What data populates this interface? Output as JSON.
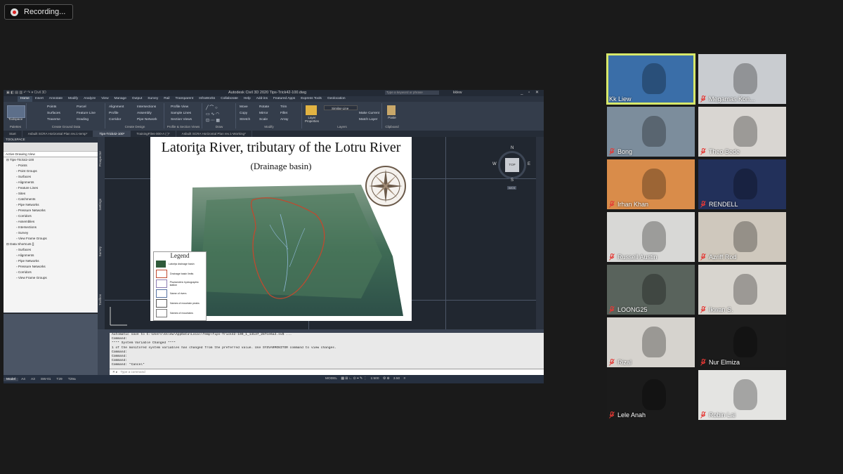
{
  "recording": {
    "label": "Recording..."
  },
  "autocad": {
    "window_title": "Autodesk Civil 3D 2020  Tips-Trick42-100.dwg",
    "workspace": "Civil 3D",
    "search_placeholder": "Type a keyword or phrase",
    "user": "kklew",
    "menu_tabs": [
      "Home",
      "Insert",
      "Annotate",
      "Modify",
      "Analyze",
      "View",
      "Manage",
      "Output",
      "Survey",
      "Rail",
      "Transparent",
      "InfraWorks",
      "Collaborate",
      "Help",
      "Add-ins",
      "Featured Apps",
      "Express Tools",
      "Geolocation"
    ],
    "ribbon": {
      "toolspace_label": "Toolspace",
      "palettes_label": "Palettes",
      "ground_col1": [
        "Points",
        "Surfaces",
        "Traverse"
      ],
      "ground_col2": [
        "Parcel",
        "Feature Line",
        "Grading"
      ],
      "ground_label": "Create Ground Data",
      "design_col1": [
        "Alignment",
        "Profile",
        "Corridor"
      ],
      "design_col2": [
        "Intersections",
        "Assembly",
        "Pipe Network"
      ],
      "design_label": "Create Design",
      "profile_col": [
        "Profile View",
        "Sample Lines",
        "Section Views"
      ],
      "profile_label": "Profile & Section Views",
      "draw_label": "Draw",
      "modify_col1": [
        "Move",
        "Copy",
        "Stretch"
      ],
      "modify_col2": [
        "Rotate",
        "Mirror",
        "Scale"
      ],
      "modify_col3": [
        "Trim",
        "Fillet",
        "Array"
      ],
      "modify_label": "Modify",
      "layer_props": "Layer Properties",
      "layer_dropdown": "Similar-Line",
      "layer_cmds": [
        "Make Current",
        "Match Layer"
      ],
      "layers_label": "Layers",
      "paste_label": "Paste",
      "clipboard_label": "Clipboard"
    },
    "doc_tabs": [
      "Start",
      "Asbuilt SCRA Horizontal Plan rev.1-temp*",
      "Tips-Trick42-100*",
      "TrainingFiles-000-A (-)*",
      "Asbuilt SCRA Horizontal Plan rev.1-Working*"
    ],
    "toolspace": {
      "title": "TOOLSPACE",
      "view": "Active Drawing View",
      "tree": [
        "Tips-Trick42-100",
        "Points",
        "Point Groups",
        "Surfaces",
        "Alignments",
        "Feature Lines",
        "Sites",
        "Catchments",
        "Pipe Networks",
        "Pressure Networks",
        "Corridors",
        "Assemblies",
        "Intersections",
        "Survey",
        "View Frame Groups",
        "Data Shortcuts []",
        "Surfaces",
        "Alignments",
        "Pipe Networks",
        "Pressure Networks",
        "Corridors",
        "View Frame Groups"
      ],
      "side_tabs": [
        "Prospector",
        "Settings",
        "Survey",
        "Toolbox"
      ]
    },
    "drawing": {
      "title": "Latoriţa River, tributary of the Lotru River",
      "subtitle": "(Drainage basin)",
      "legend_title": "Legend",
      "legend_items": [
        "Latoriţa drainage basin",
        "Drainage basin limits",
        "Pluviometric hydrographic station",
        "Name of rivers",
        "Names of mountain peaks",
        "Names of mountains"
      ],
      "viewcube": {
        "top": "TOP",
        "n": "N",
        "s": "S",
        "e": "E",
        "w": "W",
        "wcs": "WCS"
      }
    },
    "command_lines": [
      "Automatic save to C:\\Users\\kklew\\AppData\\Local\\Temp\\Tips-Trick42-100_1_13137_287ce6a2.sv$ ...",
      "Command:",
      "**** System Variable Changed ****",
      "1 of the monitored system variables has changed from the preferred value. Use SYSVARMONITOR command to view changes.",
      "Command:",
      "Command:",
      "Command:",
      "Command: *Cancel*"
    ],
    "command_placeholder": "Type a command",
    "layout_tabs": [
      "Model",
      "A4",
      "A3",
      "SW-01",
      "T29",
      "T29a"
    ],
    "status_right": "MODEL",
    "scale": "1:500",
    "elevation": "3.50"
  },
  "participants": [
    {
      "name": "Kk Liew",
      "muted": false,
      "speaker": true,
      "bg": "#3a6ea8"
    },
    {
      "name": "Megamas Kon...",
      "muted": true,
      "speaker": false,
      "bg": "#c9ccd0"
    },
    {
      "name": "Bong",
      "muted": true,
      "speaker": false,
      "bg": "#7c8d9c"
    },
    {
      "name": "Theo Bede",
      "muted": true,
      "speaker": false,
      "bg": "#d9d6d2"
    },
    {
      "name": "Irhan Khan",
      "muted": true,
      "speaker": false,
      "bg": "#d98c4a"
    },
    {
      "name": "RENDELL",
      "muted": true,
      "speaker": false,
      "bg": "#22305a"
    },
    {
      "name": "Russell Austin",
      "muted": true,
      "speaker": false,
      "bg": "#d8d8d6"
    },
    {
      "name": "Azriff Rod",
      "muted": true,
      "speaker": false,
      "bg": "#cfc8bd"
    },
    {
      "name": "LOONG25",
      "muted": true,
      "speaker": false,
      "bg": "#59635c"
    },
    {
      "name": "Ikwan S.",
      "muted": true,
      "speaker": false,
      "bg": "#d8d5cf"
    },
    {
      "name": "Rizal",
      "muted": true,
      "speaker": false,
      "bg": "#d6d3ce"
    },
    {
      "name": "Nur Elmiza",
      "muted": true,
      "speaker": false,
      "bg": "#1b1b1b"
    },
    {
      "name": "Lele Anah",
      "muted": true,
      "speaker": false,
      "bg": "#1b1b1b"
    },
    {
      "name": "Robin Lai",
      "muted": true,
      "speaker": false,
      "bg": "#e4e4e2"
    }
  ]
}
